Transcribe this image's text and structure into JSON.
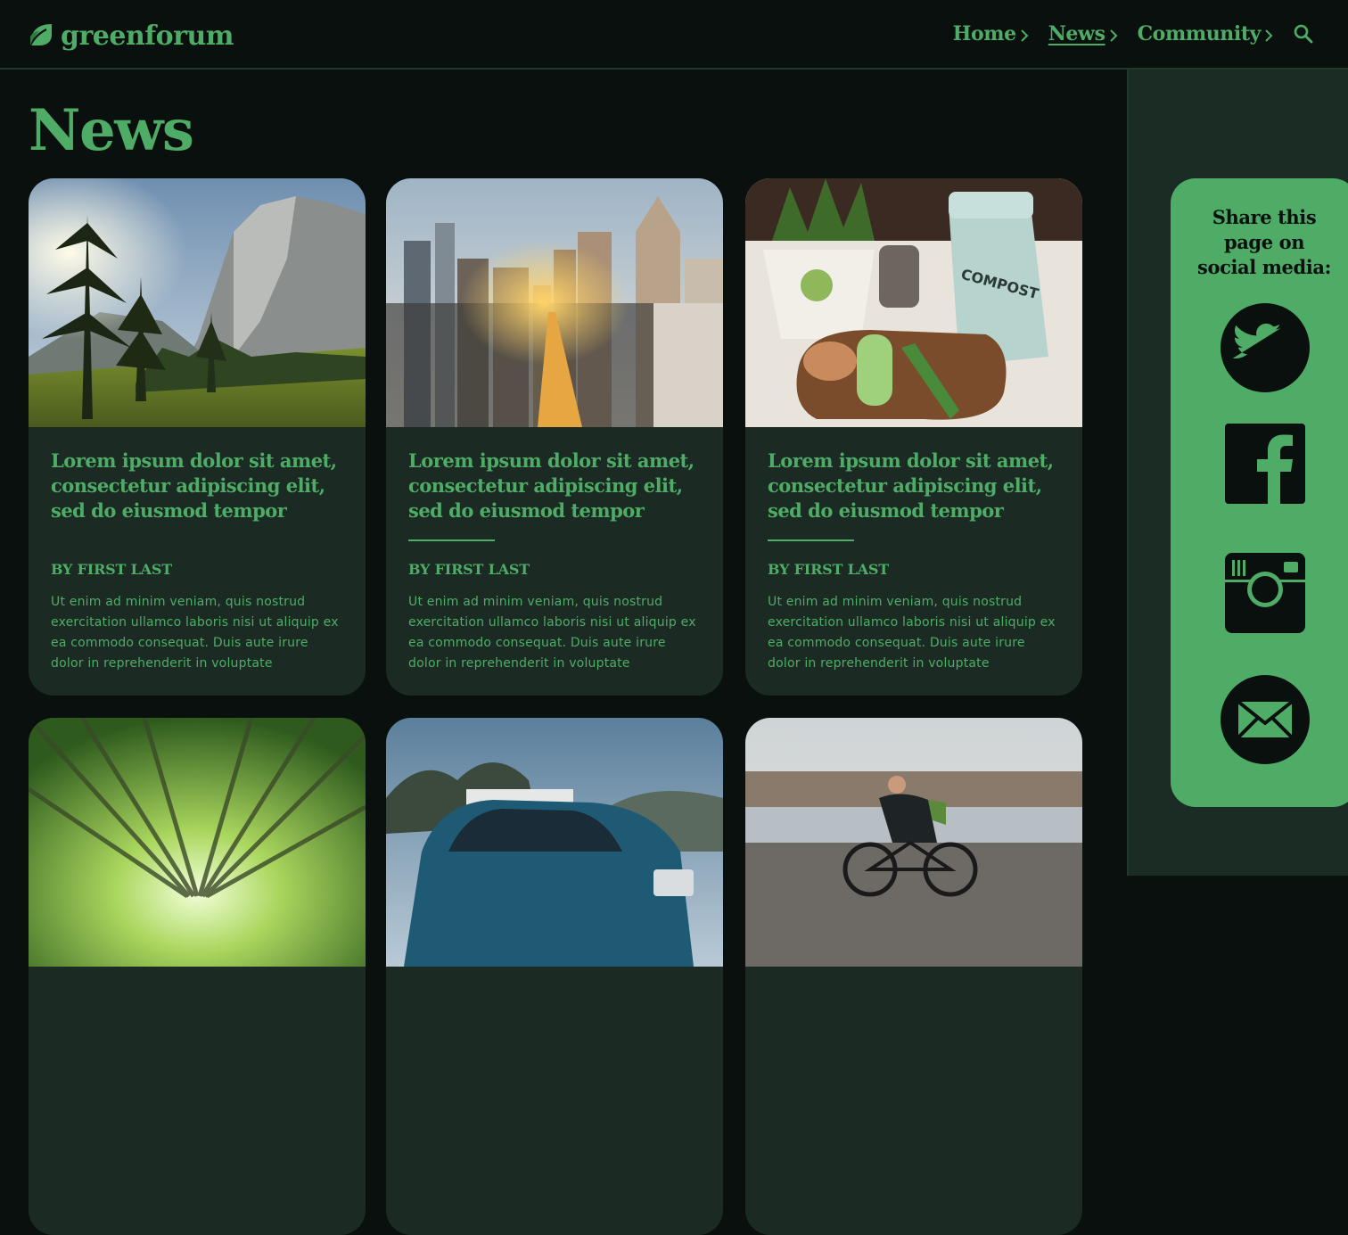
{
  "brand": {
    "name": "greenforum",
    "accent": "#4eac66",
    "background": "#0a100e",
    "card_background": "#1b2b24"
  },
  "nav": {
    "items": [
      {
        "label": "Home",
        "active": false
      },
      {
        "label": "News",
        "active": true
      },
      {
        "label": "Community",
        "active": false
      }
    ],
    "search_icon": "search-icon"
  },
  "page": {
    "title": "News"
  },
  "cards": [
    {
      "image": "mountain-meadow-photo",
      "title": "Lorem ipsum dolor sit amet, consectetur adipiscing elit, sed do eiusmod tempor",
      "byline": "BY FIRST LAST",
      "excerpt": "Ut enim ad minim veniam, quis nostrud exercitation ullamco laboris nisi ut aliquip ex ea commodo consequat. Duis aute irure dolor in reprehenderit in voluptate"
    },
    {
      "image": "city-skyline-photo",
      "title": "Lorem ipsum dolor sit amet, consectetur adipiscing elit, sed do eiusmod tempor",
      "byline": "BY FIRST LAST",
      "excerpt": "Ut enim ad minim veniam, quis nostrud exercitation ullamco laboris nisi ut aliquip ex ea commodo consequat. Duis aute irure dolor in reprehenderit in voluptate"
    },
    {
      "image": "compost-kitchen-photo",
      "title": "Lorem ipsum dolor sit amet, consectetur adipiscing elit, sed do eiusmod tempor",
      "byline": "BY FIRST LAST",
      "excerpt": "Ut enim ad minim veniam, quis nostrud exercitation ullamco laboris nisi ut aliquip ex ea commodo consequat. Duis aute irure dolor in reprehenderit in voluptate"
    },
    {
      "image": "bamboo-canopy-photo"
    },
    {
      "image": "blue-car-photo"
    },
    {
      "image": "cyclist-riverside-photo"
    }
  ],
  "share": {
    "heading_lines": [
      "Share this",
      "page on",
      "social media:"
    ],
    "networks": [
      {
        "name": "Twitter",
        "icon": "twitter-icon"
      },
      {
        "name": "Facebook",
        "icon": "facebook-icon"
      },
      {
        "name": "Instagram",
        "icon": "instagram-icon"
      },
      {
        "name": "Email",
        "icon": "mail-icon"
      }
    ]
  }
}
